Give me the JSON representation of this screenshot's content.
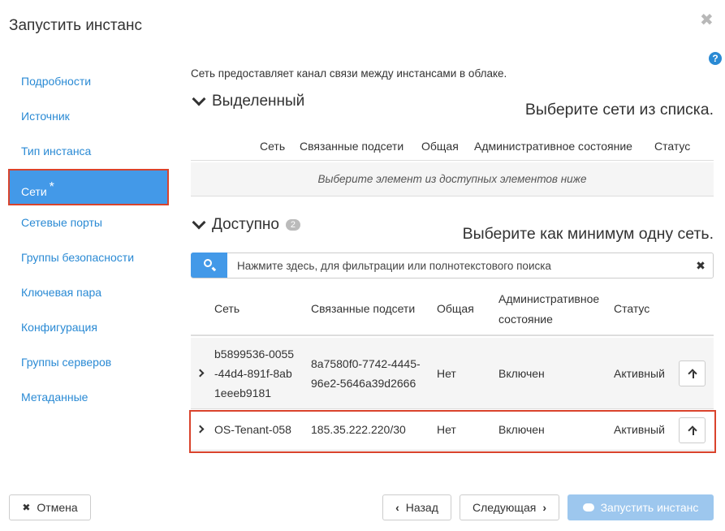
{
  "title": "Запустить инстанс",
  "close": "✖",
  "help": "?",
  "sidebar": {
    "items": [
      {
        "label": "Подробности"
      },
      {
        "label": "Источник"
      },
      {
        "label": "Тип инстанса"
      },
      {
        "label": "Сети",
        "required": "*"
      },
      {
        "label": "Сетевые порты"
      },
      {
        "label": "Группы безопасности"
      },
      {
        "label": "Ключевая пара"
      },
      {
        "label": "Конфигурация"
      },
      {
        "label": "Группы серверов"
      },
      {
        "label": "Метаданные"
      }
    ]
  },
  "main": {
    "intro": "Сеть предоставляет канал связи между инстансами в облаке.",
    "allocated": {
      "title": "Выделенный",
      "hint": "Выберите сети из списка.",
      "columns": [
        "Сеть",
        "Связанные подсети",
        "Общая",
        "Административное состояние",
        "Статус"
      ],
      "empty": "Выберите элемент из доступных элементов ниже"
    },
    "available": {
      "title": "Доступно",
      "count": "2",
      "hint": "Выберите как минимум одну сеть.",
      "search_placeholder": "Нажмите здесь, для фильтрации или полнотекстового поиска",
      "clear": "✖",
      "columns": {
        "network": "Сеть",
        "subnets": "Связанные подсети",
        "shared": "Общая",
        "admin_line1": "Административное",
        "admin_line2": "состояние",
        "status": "Статус"
      },
      "rows": [
        {
          "network_l1": "b5899536-0055",
          "network_l2": "-44d4-891f-8ab",
          "network_l3": "1eeeb9181",
          "subnets_l1": "8a7580f0-7742-4445-",
          "subnets_l2": "96e2-5646a39d2666",
          "shared": "Нет",
          "admin": "Включен",
          "status": "Активный"
        },
        {
          "network": "OS-Tenant-058",
          "subnets": "185.35.222.220/30",
          "shared": "Нет",
          "admin": "Включен",
          "status": "Активный"
        }
      ]
    }
  },
  "footer": {
    "cancel": "Отмена",
    "back": "Назад",
    "next": "Следующая",
    "launch": "Запустить инстанс",
    "cancel_icon": "✖",
    "back_icon": "‹",
    "next_icon": "›"
  },
  "colors": {
    "accent": "#4399e8",
    "link": "#2a8ad4",
    "highlight": "#d9432c",
    "launch_disabled": "#9dc7ee"
  }
}
